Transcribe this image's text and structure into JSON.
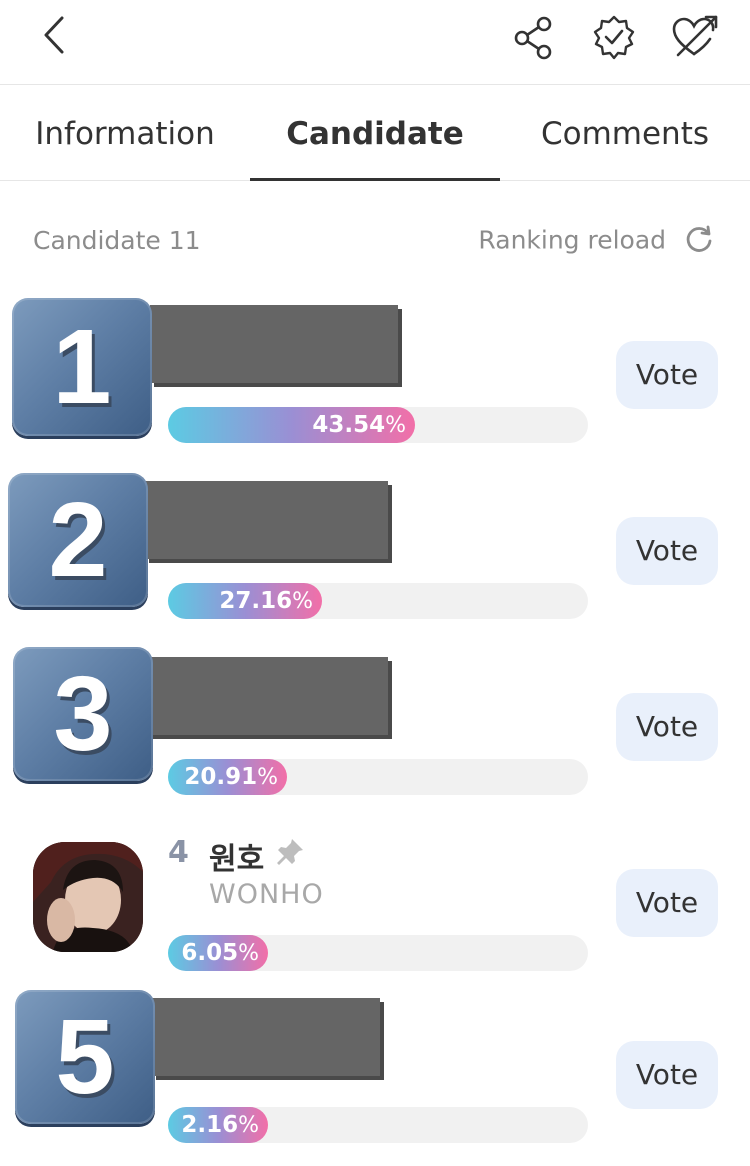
{
  "header": {
    "back_icon": "chevron-left-icon",
    "share_icon": "share-icon",
    "verified_icon": "verified-badge-icon",
    "heart_icon": "heart-arrow-icon"
  },
  "tabs": [
    {
      "label": "Information",
      "active": false
    },
    {
      "label": "Candidate",
      "active": true
    },
    {
      "label": "Comments",
      "active": false
    }
  ],
  "candidate_count_label": "Candidate 11",
  "ranking_reload_label": "Ranking reload",
  "vote_label": "Vote",
  "percent_unit": "%",
  "candidates": [
    {
      "rank": "1",
      "percent": "43.54",
      "percent_value": 43.54
    },
    {
      "rank": "2",
      "percent": "27.16",
      "percent_value": 27.16
    },
    {
      "rank": "3",
      "percent": "20.91",
      "percent_value": 20.91
    },
    {
      "rank": "4",
      "name_ko": "원호",
      "name_en": "WONHO",
      "percent": "6.05",
      "percent_value": 6.05
    },
    {
      "rank": "5",
      "percent": "2.16",
      "percent_value": 2.16
    }
  ],
  "colors": {
    "bar_start": "#5ccbe3",
    "bar_end": "#f26fa8",
    "vote_bg": "#e9f0fb",
    "badge": "#5f7fa6"
  }
}
